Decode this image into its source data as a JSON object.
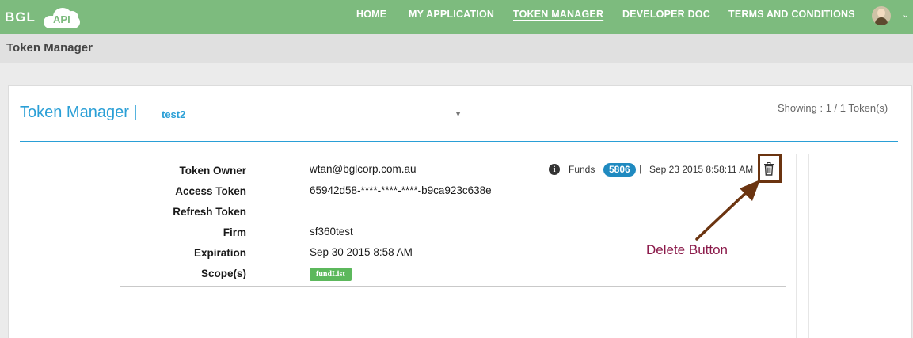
{
  "brand": {
    "name": "BGL",
    "badge": "API"
  },
  "nav": {
    "items": [
      {
        "label": "HOME"
      },
      {
        "label": "MY APPLICATION"
      },
      {
        "label": "TOKEN MANAGER"
      },
      {
        "label": "DEVELOPER DOC"
      },
      {
        "label": "TERMS AND CONDITIONS"
      }
    ],
    "active_index": 2
  },
  "page": {
    "title": "Token Manager"
  },
  "panel": {
    "title": "Token Manager |",
    "selected_token": "test2",
    "showing": "Showing : 1 / 1 Token(s)"
  },
  "token": {
    "labels": {
      "owner": "Token Owner",
      "access": "Access Token",
      "refresh": "Refresh Token",
      "firm": "Firm",
      "expiration": "Expiration",
      "scope": "Scope(s)"
    },
    "values": {
      "owner": "wtan@bglcorp.com.au",
      "access": "65942d58-****-****-****-b9ca923c638e",
      "refresh": "",
      "firm": "sf360test",
      "expiration": "Sep 30 2015 8:58 AM"
    },
    "scopes": [
      "fundList"
    ],
    "funds_label": "Funds",
    "funds_count": "5806",
    "separator": "|",
    "issued": "Sep 23 2015 8:58:11 AM"
  },
  "annotation": {
    "text": "Delete Button"
  },
  "colors": {
    "navbar": "#7dbb7e",
    "accent_blue": "#2a9fd6",
    "scope_green": "#5cb85c",
    "badge_blue": "#1f8ac0",
    "annotation_brown": "#6b3410",
    "annotation_text": "#8b1a4a"
  },
  "icons": {
    "info": "info-icon",
    "delete": "trash-icon",
    "select_caret": "caret-down-icon",
    "user_menu": "chevron-down-icon"
  }
}
